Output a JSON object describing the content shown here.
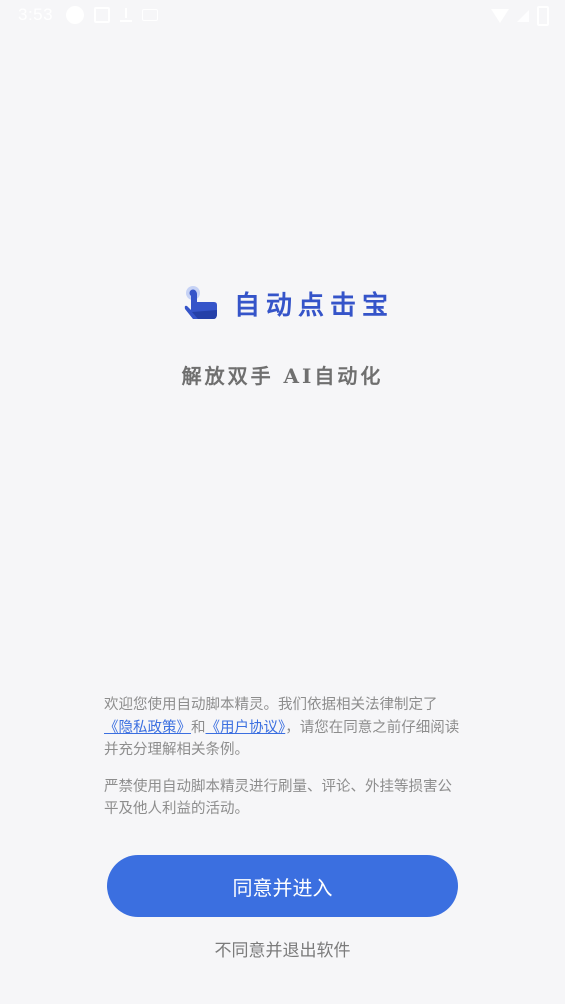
{
  "status_bar": {
    "time": "3:53",
    "left_icons": [
      "app-circle-icon",
      "notification-box-icon",
      "download-icon",
      "keyboard-icon"
    ],
    "right_icons": [
      "wifi-icon",
      "signal-icon",
      "battery-icon"
    ]
  },
  "splash": {
    "app_name": "自动点击宝",
    "slogan": "解放双手 AI自动化",
    "logo_icon": "tap-hand-icon",
    "brand_color": "#3554c9"
  },
  "notice": {
    "paragraph1_text_a": "欢迎您使用自动脚本精灵。我们依据相关法律制定了",
    "privacy_link": "《隐私政策》",
    "conjunction": "和",
    "agreement_link": "《用户协议》",
    "paragraph1_text_b": "，请您在同意之前仔细阅读并充分理解相关条例。",
    "paragraph2": "严禁使用自动脚本精灵进行刷量、评论、外挂等损害公平及他人利益的活动。"
  },
  "actions": {
    "agree_label": "同意并进入",
    "exit_label": "不同意并退出软件",
    "accent_color": "#3b6fe0"
  }
}
